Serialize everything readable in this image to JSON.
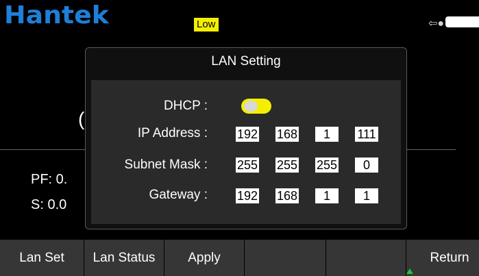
{
  "status_bar": {
    "brand": "Hantek",
    "range_badge": "Low"
  },
  "background": {
    "partial_1": "(",
    "pf_text": "PF: 0.",
    "s_text": "S: 0.0"
  },
  "dialog": {
    "title": "LAN Setting",
    "dhcp_label": "DHCP :",
    "dhcp_enabled": false,
    "ip_label": "IP Address :",
    "ip": [
      "192",
      "168",
      "1",
      "111"
    ],
    "mask_label": "Subnet Mask :",
    "mask": [
      "255",
      "255",
      "255",
      "0"
    ],
    "gateway_label": "Gateway :",
    "gateway": [
      "192",
      "168",
      "1",
      "1"
    ]
  },
  "softkeys": [
    "Lan Set",
    "Lan Status",
    "Apply",
    "",
    "",
    "Return"
  ],
  "icons": {
    "usb": "usb-icon",
    "battery": "battery-icon",
    "return_arrow": "arrow-up-icon"
  },
  "colors": {
    "brand": "#1f7fd8",
    "badge": "#f4ef00",
    "toggle": "#f4ef00"
  }
}
